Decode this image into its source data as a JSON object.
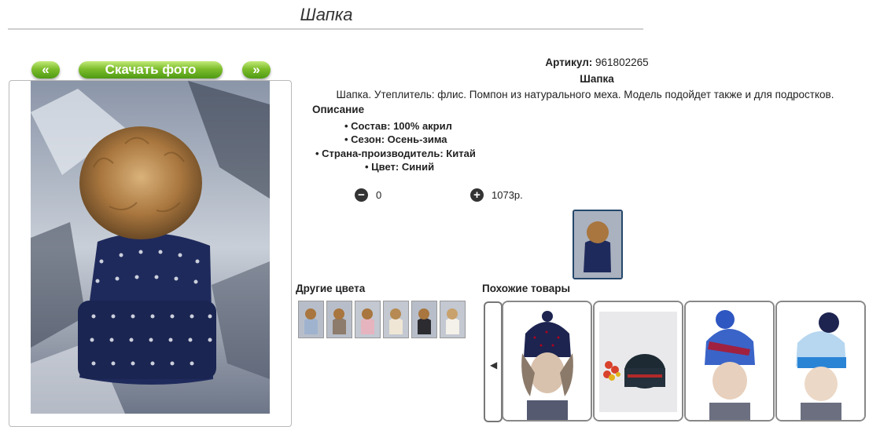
{
  "page": {
    "title": "Шапка"
  },
  "gallery": {
    "prev_label": "«",
    "download_label": "Скачать фото",
    "next_label": "»"
  },
  "product": {
    "article_label": "Артикул:",
    "article_value": "961802265",
    "name": "Шапка",
    "description": "Шапка. Утеплитель: флис. Помпон из натурального меха. Модель подойдет также и для подростков.",
    "description_heading": "Описание",
    "attributes": [
      "• Состав: 100% акрил",
      "• Сезон: Осень-зима",
      "• Страна-производитель: Китай",
      "• Цвет: Синий"
    ],
    "quantity": "0",
    "price": "1073р.",
    "minus_symbol": "−",
    "plus_symbol": "+"
  },
  "other_colors": {
    "heading": "Другие цвета"
  },
  "similar": {
    "heading": "Похожие товары",
    "prev_symbol": "◀"
  },
  "colors": {
    "accent_green": "#5aa81b",
    "hat_navy": "#1f2a5c",
    "thumb_border": "#25476b"
  }
}
